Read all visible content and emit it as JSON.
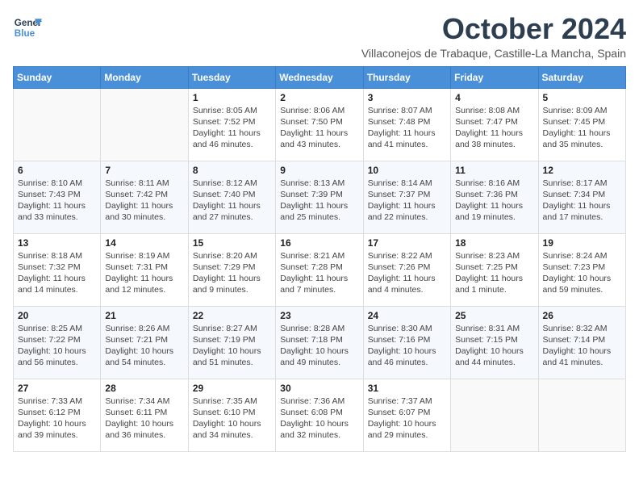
{
  "header": {
    "logo_line1": "General",
    "logo_line2": "Blue",
    "month_title": "October 2024",
    "location": "Villaconejos de Trabaque, Castille-La Mancha, Spain"
  },
  "weekdays": [
    "Sunday",
    "Monday",
    "Tuesday",
    "Wednesday",
    "Thursday",
    "Friday",
    "Saturday"
  ],
  "weeks": [
    [
      {
        "day": "",
        "info": ""
      },
      {
        "day": "",
        "info": ""
      },
      {
        "day": "1",
        "info": "Sunrise: 8:05 AM\nSunset: 7:52 PM\nDaylight: 11 hours and 46 minutes."
      },
      {
        "day": "2",
        "info": "Sunrise: 8:06 AM\nSunset: 7:50 PM\nDaylight: 11 hours and 43 minutes."
      },
      {
        "day": "3",
        "info": "Sunrise: 8:07 AM\nSunset: 7:48 PM\nDaylight: 11 hours and 41 minutes."
      },
      {
        "day": "4",
        "info": "Sunrise: 8:08 AM\nSunset: 7:47 PM\nDaylight: 11 hours and 38 minutes."
      },
      {
        "day": "5",
        "info": "Sunrise: 8:09 AM\nSunset: 7:45 PM\nDaylight: 11 hours and 35 minutes."
      }
    ],
    [
      {
        "day": "6",
        "info": "Sunrise: 8:10 AM\nSunset: 7:43 PM\nDaylight: 11 hours and 33 minutes."
      },
      {
        "day": "7",
        "info": "Sunrise: 8:11 AM\nSunset: 7:42 PM\nDaylight: 11 hours and 30 minutes."
      },
      {
        "day": "8",
        "info": "Sunrise: 8:12 AM\nSunset: 7:40 PM\nDaylight: 11 hours and 27 minutes."
      },
      {
        "day": "9",
        "info": "Sunrise: 8:13 AM\nSunset: 7:39 PM\nDaylight: 11 hours and 25 minutes."
      },
      {
        "day": "10",
        "info": "Sunrise: 8:14 AM\nSunset: 7:37 PM\nDaylight: 11 hours and 22 minutes."
      },
      {
        "day": "11",
        "info": "Sunrise: 8:16 AM\nSunset: 7:36 PM\nDaylight: 11 hours and 19 minutes."
      },
      {
        "day": "12",
        "info": "Sunrise: 8:17 AM\nSunset: 7:34 PM\nDaylight: 11 hours and 17 minutes."
      }
    ],
    [
      {
        "day": "13",
        "info": "Sunrise: 8:18 AM\nSunset: 7:32 PM\nDaylight: 11 hours and 14 minutes."
      },
      {
        "day": "14",
        "info": "Sunrise: 8:19 AM\nSunset: 7:31 PM\nDaylight: 11 hours and 12 minutes."
      },
      {
        "day": "15",
        "info": "Sunrise: 8:20 AM\nSunset: 7:29 PM\nDaylight: 11 hours and 9 minutes."
      },
      {
        "day": "16",
        "info": "Sunrise: 8:21 AM\nSunset: 7:28 PM\nDaylight: 11 hours and 7 minutes."
      },
      {
        "day": "17",
        "info": "Sunrise: 8:22 AM\nSunset: 7:26 PM\nDaylight: 11 hours and 4 minutes."
      },
      {
        "day": "18",
        "info": "Sunrise: 8:23 AM\nSunset: 7:25 PM\nDaylight: 11 hours and 1 minute."
      },
      {
        "day": "19",
        "info": "Sunrise: 8:24 AM\nSunset: 7:23 PM\nDaylight: 10 hours and 59 minutes."
      }
    ],
    [
      {
        "day": "20",
        "info": "Sunrise: 8:25 AM\nSunset: 7:22 PM\nDaylight: 10 hours and 56 minutes."
      },
      {
        "day": "21",
        "info": "Sunrise: 8:26 AM\nSunset: 7:21 PM\nDaylight: 10 hours and 54 minutes."
      },
      {
        "day": "22",
        "info": "Sunrise: 8:27 AM\nSunset: 7:19 PM\nDaylight: 10 hours and 51 minutes."
      },
      {
        "day": "23",
        "info": "Sunrise: 8:28 AM\nSunset: 7:18 PM\nDaylight: 10 hours and 49 minutes."
      },
      {
        "day": "24",
        "info": "Sunrise: 8:30 AM\nSunset: 7:16 PM\nDaylight: 10 hours and 46 minutes."
      },
      {
        "day": "25",
        "info": "Sunrise: 8:31 AM\nSunset: 7:15 PM\nDaylight: 10 hours and 44 minutes."
      },
      {
        "day": "26",
        "info": "Sunrise: 8:32 AM\nSunset: 7:14 PM\nDaylight: 10 hours and 41 minutes."
      }
    ],
    [
      {
        "day": "27",
        "info": "Sunrise: 7:33 AM\nSunset: 6:12 PM\nDaylight: 10 hours and 39 minutes."
      },
      {
        "day": "28",
        "info": "Sunrise: 7:34 AM\nSunset: 6:11 PM\nDaylight: 10 hours and 36 minutes."
      },
      {
        "day": "29",
        "info": "Sunrise: 7:35 AM\nSunset: 6:10 PM\nDaylight: 10 hours and 34 minutes."
      },
      {
        "day": "30",
        "info": "Sunrise: 7:36 AM\nSunset: 6:08 PM\nDaylight: 10 hours and 32 minutes."
      },
      {
        "day": "31",
        "info": "Sunrise: 7:37 AM\nSunset: 6:07 PM\nDaylight: 10 hours and 29 minutes."
      },
      {
        "day": "",
        "info": ""
      },
      {
        "day": "",
        "info": ""
      }
    ]
  ]
}
